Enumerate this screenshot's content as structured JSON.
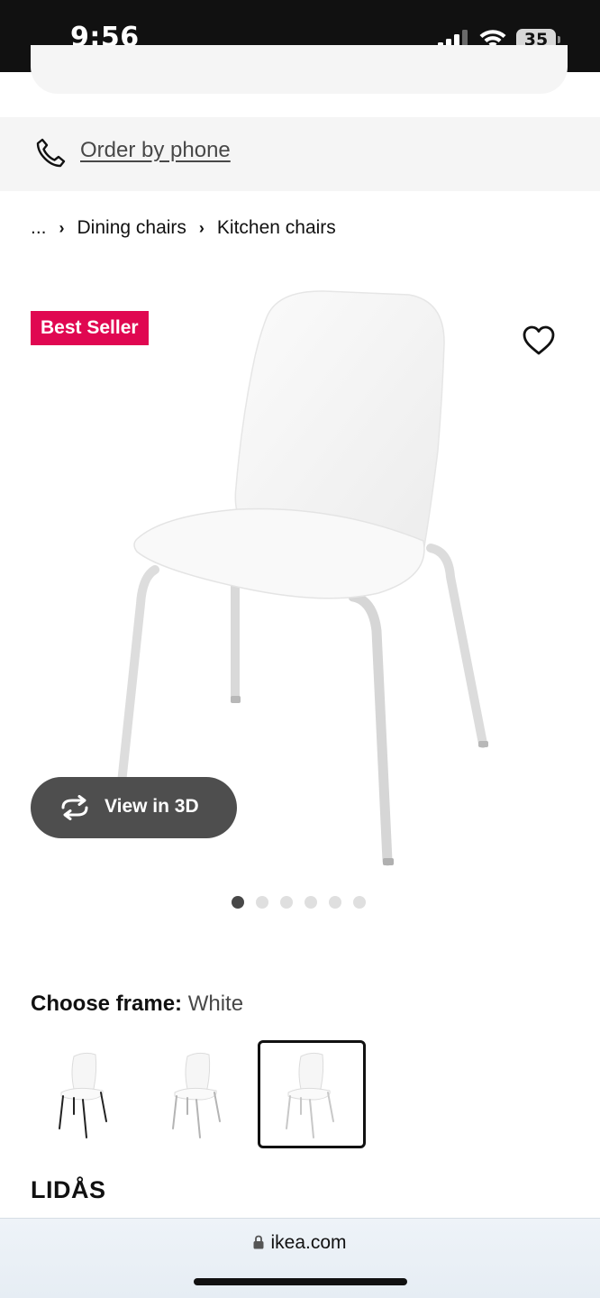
{
  "status_bar": {
    "time": "9:56",
    "battery": "35"
  },
  "header": {
    "order_by_phone_label": "Order by phone"
  },
  "breadcrumb": {
    "items": [
      "...",
      "Dining chairs",
      "Kitchen chairs"
    ]
  },
  "product": {
    "badge": "Best Seller",
    "view_3d_label": "View in 3D",
    "image_count": 6,
    "active_image_index": 0,
    "name": "LIDÅS"
  },
  "options": {
    "choose_label": "Choose frame:",
    "selected_value": "White",
    "swatches": [
      {
        "name": "Black",
        "leg_color": "#222222"
      },
      {
        "name": "Silver",
        "leg_color": "#c4c4c4"
      },
      {
        "name": "White",
        "leg_color": "#d6d6d6",
        "selected": true
      }
    ]
  },
  "browser": {
    "url": "ikea.com"
  },
  "colors": {
    "badge": "#e00751",
    "status_bar": "#111111",
    "view_3d_button": "#4e4e4e"
  },
  "icons": [
    "signal-icon",
    "wifi-icon",
    "battery-icon",
    "phone-icon",
    "chevron-right-icon",
    "heart-icon",
    "rotate-3d-icon",
    "lock-icon"
  ]
}
